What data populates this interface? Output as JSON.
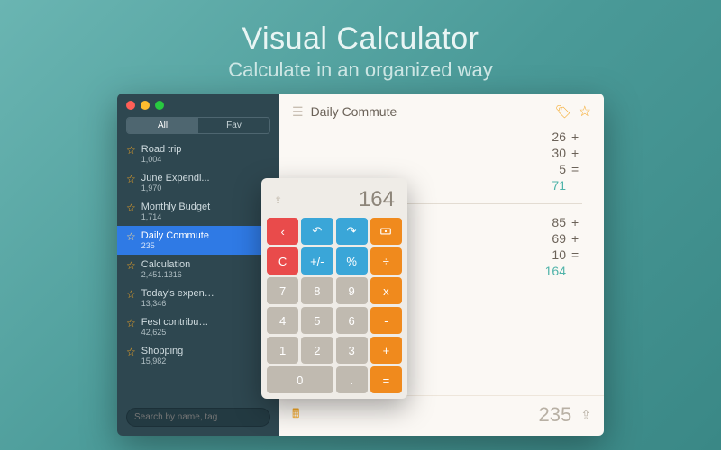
{
  "hero": {
    "title": "Visual Calculator",
    "subtitle": "Calculate in an organized way"
  },
  "segmented": {
    "all": "All",
    "fav": "Fav"
  },
  "sidebar": {
    "items": [
      {
        "name": "Road trip",
        "value": "1,004"
      },
      {
        "name": "June Expendi...",
        "value": "1,970"
      },
      {
        "name": "Monthly Budget",
        "value": "1,714"
      },
      {
        "name": "Daily Commute",
        "value": "235"
      },
      {
        "name": "Calculation",
        "value": "2,451.1316"
      },
      {
        "name": "Today's expen…",
        "value": "13,346"
      },
      {
        "name": "Fest contribu…",
        "value": "42,625"
      },
      {
        "name": "Shopping",
        "value": "15,982"
      }
    ],
    "search_placeholder": "Search by name, tag"
  },
  "doc": {
    "title": "Daily Commute",
    "tape": {
      "block1": [
        {
          "n": "26",
          "op": "+"
        },
        {
          "n": "30",
          "op": "+"
        },
        {
          "n": "5",
          "op": "="
        }
      ],
      "result1": "71",
      "block2": [
        {
          "n": "85",
          "op": "+"
        },
        {
          "n": "69",
          "op": "+"
        },
        {
          "n": "10",
          "op": "="
        }
      ],
      "result2": "164"
    },
    "total": "235"
  },
  "calc": {
    "display": "164",
    "keys": {
      "back": "‹",
      "undo": "↶",
      "redo": "↷",
      "cash": "▭",
      "clear": "C",
      "sign": "+/-",
      "pct": "%",
      "div": "÷",
      "k7": "7",
      "k8": "8",
      "k9": "9",
      "mul": "x",
      "k4": "4",
      "k5": "5",
      "k6": "6",
      "sub": "-",
      "k1": "1",
      "k2": "2",
      "k3": "3",
      "add": "+",
      "k0": "0",
      "dot": ".",
      "eq": "="
    }
  }
}
